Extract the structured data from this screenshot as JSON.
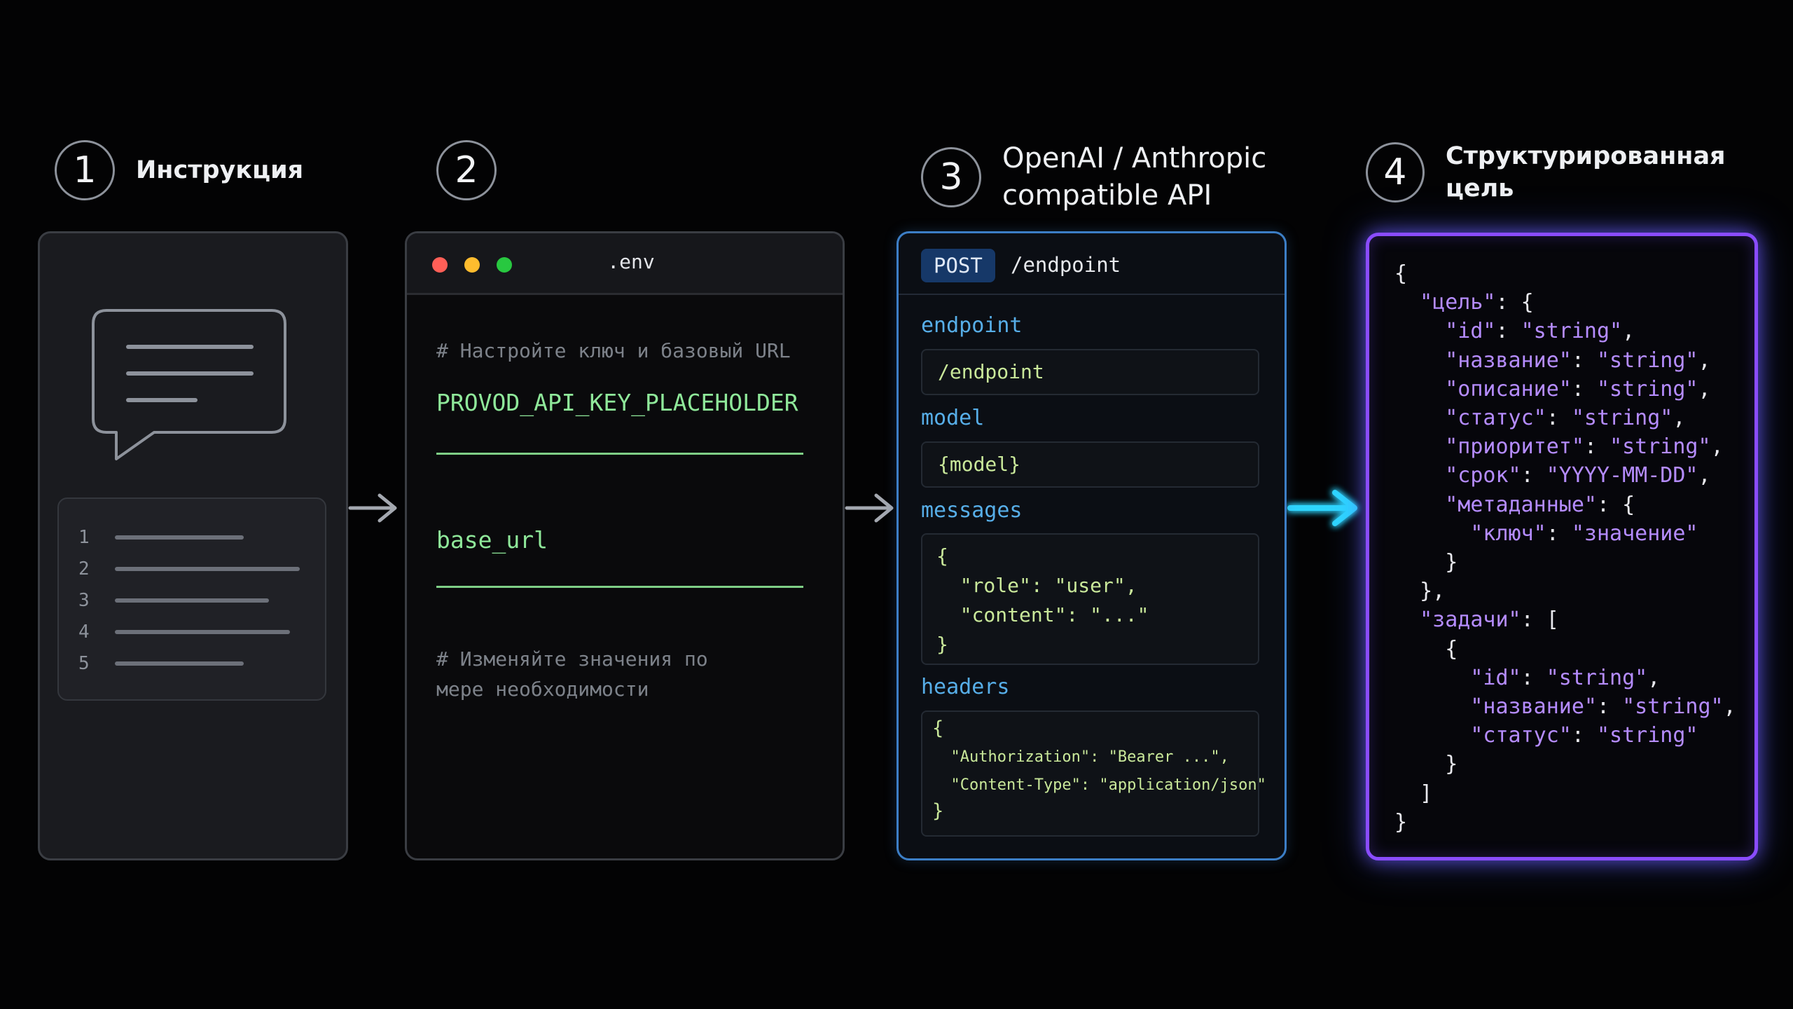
{
  "steps": [
    {
      "number": "1",
      "label": "Инструкция"
    },
    {
      "number": "2",
      "label": ""
    },
    {
      "number": "3",
      "label_line1": "OpenAI / Anthropic",
      "label_line2": "compatible API"
    },
    {
      "number": "4",
      "label": "Структурированная цель"
    }
  ],
  "instruction_panel": {
    "list_numbers": [
      "1",
      "2",
      "3",
      "4",
      "5"
    ],
    "icons": [
      "chat-bubble-icon",
      "numbered-list-icon"
    ]
  },
  "env_panel": {
    "filename": ".env",
    "window_dots": [
      "#ff5f57",
      "#febc2e",
      "#28c840"
    ],
    "comment_top": "# Настройте ключ и базовый URL",
    "api_key": "PROVOD_API_KEY_PLACEHOLDER",
    "base_url": "base_url",
    "comment_bottom_line1": "# Изменяйте значения по",
    "comment_bottom_line2": "мере необходимости"
  },
  "api_panel": {
    "method": "POST",
    "path": "/endpoint",
    "fields": {
      "endpoint_label": "endpoint",
      "endpoint_value": "/endpoint",
      "model_label": "model",
      "model_value": "{model}",
      "messages_label": "messages",
      "messages_lines": [
        "{",
        "  \"role\": \"user\",",
        "  \"content\": \"...\"",
        "}"
      ],
      "headers_label": "headers",
      "headers_lines": [
        "{",
        "  \"Authorization\": \"Bearer ...\",",
        "  \"Content-Type\": \"application/json\"",
        "}"
      ]
    }
  },
  "goal_panel": {
    "json_lines": [
      "{",
      "  \"цель\": {",
      "    \"id\": \"string\",",
      "    \"название\": \"string\",",
      "    \"описание\": \"string\",",
      "    \"статус\": \"string\",",
      "    \"приоритет\": \"string\",",
      "    \"срок\": \"YYYY-MM-DD\",",
      "    \"метаданные\": {",
      "      \"ключ\": \"значение\"",
      "    }",
      "  },",
      "  \"задачи\": [",
      "    {",
      "      \"id\": \"string\",",
      "      \"название\": \"string\",",
      "      \"статус\": \"string\"",
      "    }",
      "  ]",
      "}"
    ]
  },
  "colors": {
    "accent_green": "#8fe89a",
    "accent_blue": "#57aee8",
    "accent_purple": "#8a4cff",
    "arrow_cyan": "#2fd6ff"
  }
}
